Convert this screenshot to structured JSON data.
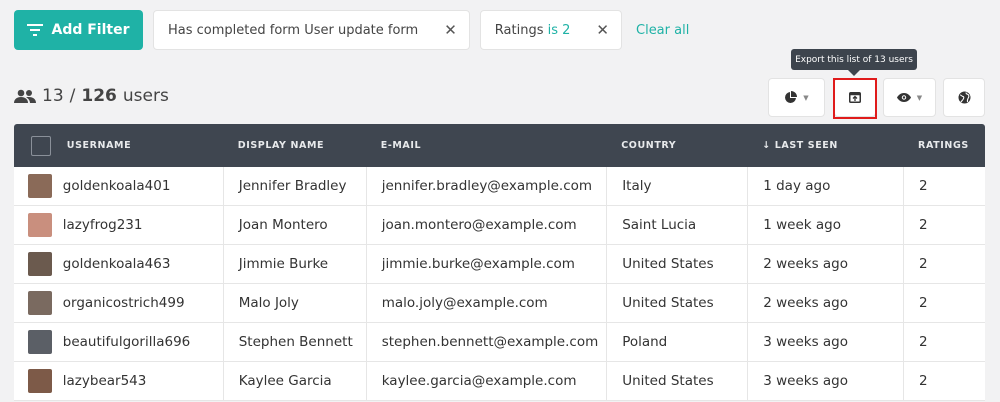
{
  "filters": {
    "add_label": "Add Filter",
    "chip1_text": "Has completed form User update form",
    "chip2_field": "Ratings",
    "chip2_op": "is 2",
    "close_glyph": "✕",
    "clear_all": "Clear all"
  },
  "tooltip": "Export this list of 13 users",
  "summary": {
    "shown": "13",
    "sep": "/",
    "total": "126",
    "unit": "users"
  },
  "toolbar": {
    "caret": "▼"
  },
  "table": {
    "headers": {
      "username": "USERNAME",
      "display": "DISPLAY NAME",
      "email": "E-MAIL",
      "country": "COUNTRY",
      "seen": "↓ LAST SEEN",
      "ratings": "RATINGS"
    },
    "rows": [
      {
        "username": "goldenkoala401",
        "display": "Jennifer Bradley",
        "email": "jennifer.bradley@example.com",
        "country": "Italy",
        "seen": "1 day ago",
        "rating": "2",
        "avatar_color": "#8a6a58"
      },
      {
        "username": "lazyfrog231",
        "display": "Joan Montero",
        "email": "joan.montero@example.com",
        "country": "Saint Lucia",
        "seen": "1 week ago",
        "rating": "2",
        "avatar_color": "#c98f7e"
      },
      {
        "username": "goldenkoala463",
        "display": "Jimmie Burke",
        "email": "jimmie.burke@example.com",
        "country": "United States",
        "seen": "2 weeks ago",
        "rating": "2",
        "avatar_color": "#6b5a4e"
      },
      {
        "username": "organicostrich499",
        "display": "Malo Joly",
        "email": "malo.joly@example.com",
        "country": "United States",
        "seen": "2 weeks ago",
        "rating": "2",
        "avatar_color": "#7a6a60"
      },
      {
        "username": "beautifulgorilla696",
        "display": "Stephen Bennett",
        "email": "stephen.bennett@example.com",
        "country": "Poland",
        "seen": "3 weeks ago",
        "rating": "2",
        "avatar_color": "#5b5f66"
      },
      {
        "username": "lazybear543",
        "display": "Kaylee Garcia",
        "email": "kaylee.garcia@example.com",
        "country": "United States",
        "seen": "3 weeks ago",
        "rating": "2",
        "avatar_color": "#7d5a48"
      }
    ]
  }
}
